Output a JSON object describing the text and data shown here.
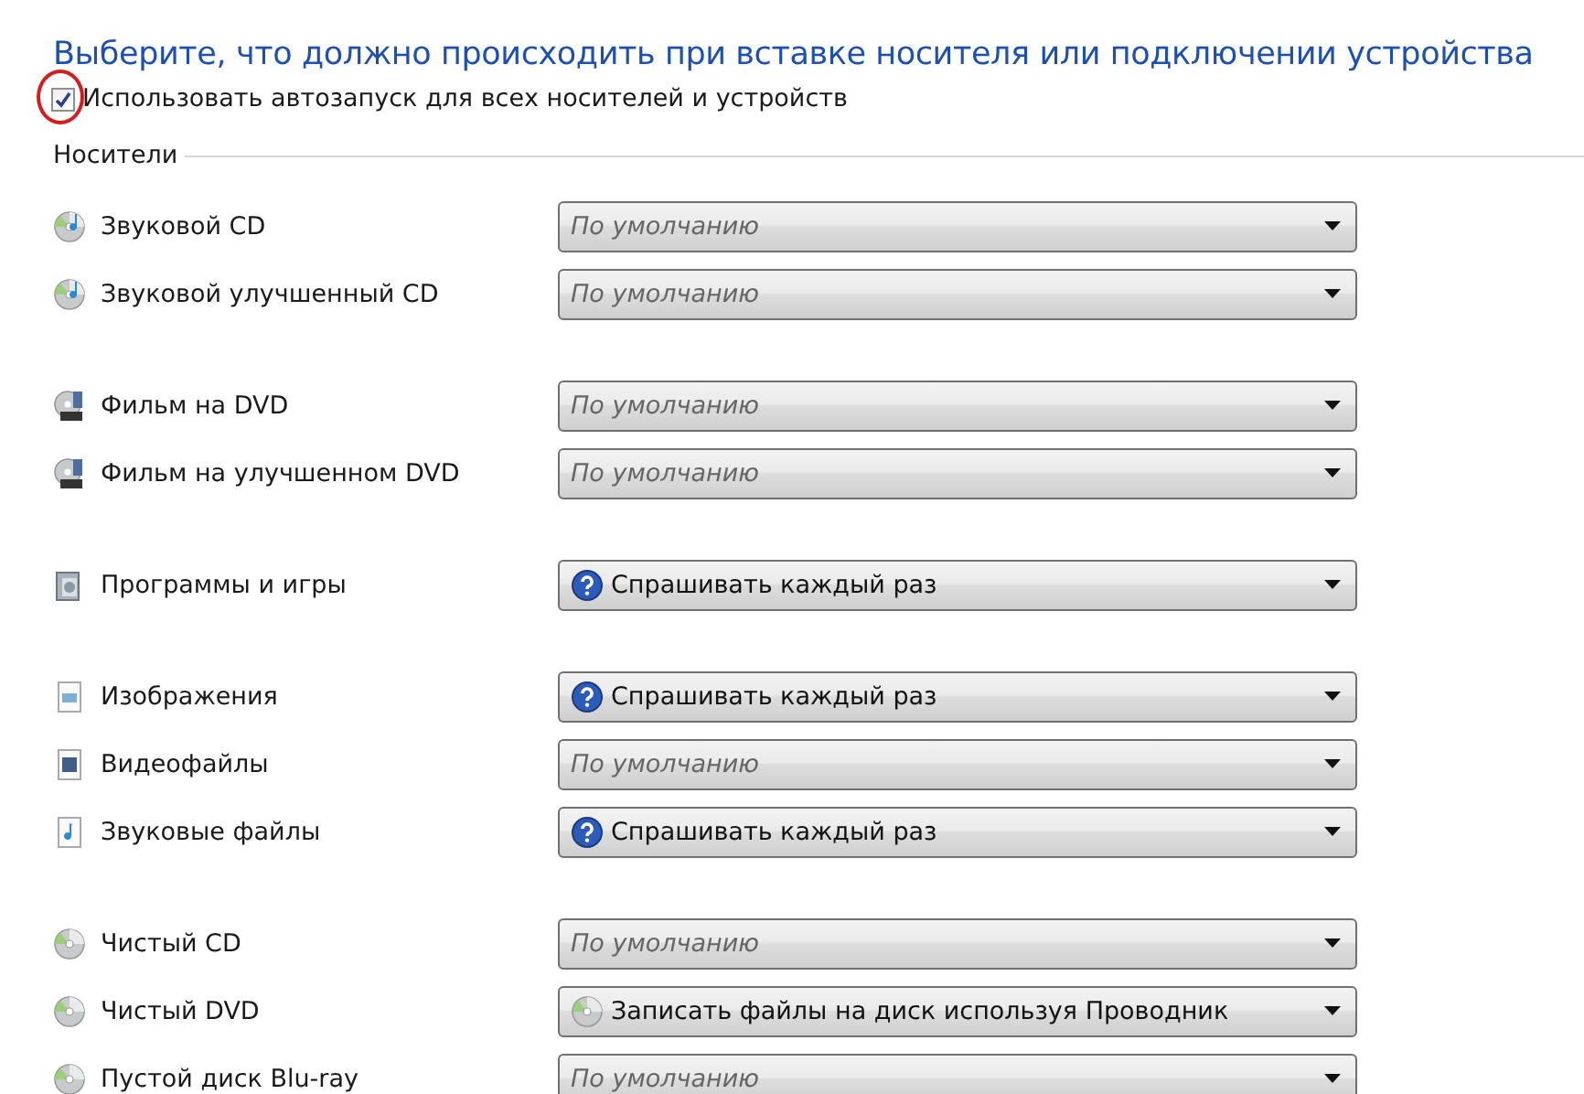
{
  "heading": "Выберите, что должно происходить при вставке носителя или подключении устройства",
  "autoplay": {
    "label": "Использовать автозапуск для всех носителей и устройств",
    "checked": true
  },
  "section": "Носители",
  "groups": [
    {
      "items": [
        {
          "kind": "audio",
          "label": "Звуковой CD",
          "action": {
            "kind": "default",
            "text": "По умолчанию"
          }
        },
        {
          "kind": "audio",
          "label": "Звуковой улучшенный CD",
          "action": {
            "kind": "default",
            "text": "По умолчанию"
          }
        }
      ]
    },
    {
      "items": [
        {
          "kind": "movie",
          "label": "Фильм на DVD",
          "action": {
            "kind": "default",
            "text": "По умолчанию"
          }
        },
        {
          "kind": "movie",
          "label": "Фильм на улучшенном DVD",
          "action": {
            "kind": "default",
            "text": "По умолчанию"
          }
        }
      ]
    },
    {
      "items": [
        {
          "kind": "software",
          "label": "Программы и игры",
          "action": {
            "kind": "ask",
            "text": "Спрашивать каждый раз"
          }
        }
      ]
    },
    {
      "items": [
        {
          "kind": "picture",
          "label": "Изображения",
          "action": {
            "kind": "ask",
            "text": "Спрашивать каждый раз"
          }
        },
        {
          "kind": "video",
          "label": "Видеофайлы",
          "action": {
            "kind": "default",
            "text": "По умолчанию"
          }
        },
        {
          "kind": "music",
          "label": "Звуковые файлы",
          "action": {
            "kind": "ask",
            "text": "Спрашивать каждый раз"
          }
        }
      ]
    },
    {
      "items": [
        {
          "kind": "blank",
          "label": "Чистый CD",
          "action": {
            "kind": "default",
            "text": "По умолчанию"
          }
        },
        {
          "kind": "blank",
          "label": "Чистый DVD",
          "action": {
            "kind": "burn",
            "text": "Записать файлы на диск используя Проводник"
          }
        },
        {
          "kind": "blank",
          "label": "Пустой диск Blu-ray",
          "action": {
            "kind": "default",
            "text": "По умолчанию"
          }
        }
      ]
    }
  ]
}
